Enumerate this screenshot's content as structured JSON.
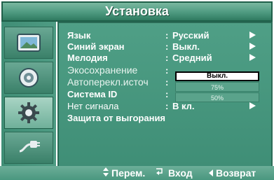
{
  "title": "Установка",
  "sidebar": {
    "items": [
      {
        "icon": "picture-icon",
        "active": false
      },
      {
        "icon": "sound-icon",
        "active": false
      },
      {
        "icon": "settings-gear-icon",
        "active": true
      },
      {
        "icon": "input-plug-icon",
        "active": false
      }
    ]
  },
  "menu": {
    "rows": [
      {
        "label": "Язык",
        "value": "Русский",
        "arrow": true
      },
      {
        "label": "Синий экран",
        "value": "Выкл.",
        "arrow": true
      },
      {
        "label": "Мелодия",
        "value": "Средний",
        "arrow": true
      },
      {
        "label": "Экосохранение",
        "value": "",
        "arrow": false
      },
      {
        "label": "Автоперекл.источ",
        "value": "",
        "arrow": false
      },
      {
        "label": "Система ID",
        "value": "",
        "arrow": false
      },
      {
        "label": "Нет сигнала",
        "value": "В кл.",
        "arrow": true
      },
      {
        "label": "Защита от выгорания",
        "value": "",
        "arrow": false
      }
    ],
    "colon": ":"
  },
  "dropdown": {
    "options": [
      "Выкл.",
      "75%",
      "50%"
    ],
    "selected": "Выкл."
  },
  "footer": {
    "move": "Перем.",
    "enter": "Вход",
    "back": "Возврат"
  },
  "colors": {
    "panel": "#4f9f86",
    "title_bar": "#4e9a80",
    "text": "#ffffff"
  }
}
